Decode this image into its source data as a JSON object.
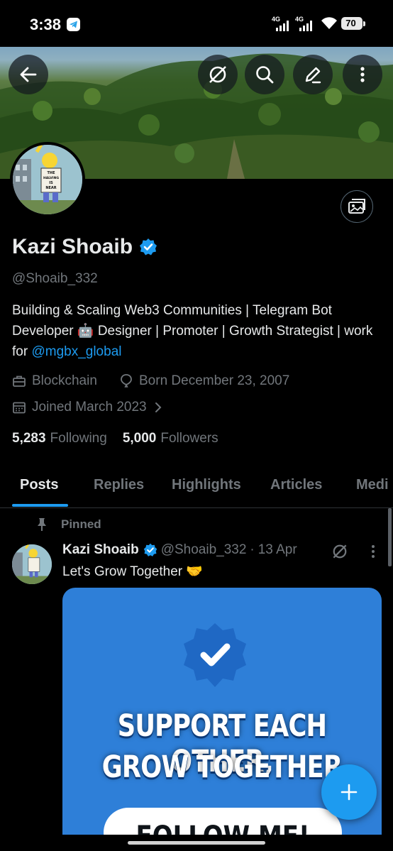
{
  "status_bar": {
    "time": "3:38",
    "signal_1_label": "4G",
    "signal_2_label": "4G",
    "battery": "70"
  },
  "header": {
    "back_icon": "arrow-left-icon",
    "grok_icon": "grok-icon",
    "search_icon": "search-icon",
    "edit_icon": "pencil-icon",
    "more_icon": "more-vertical-icon"
  },
  "profile": {
    "name": "Kazi Shoaib",
    "handle": "@Shoaib_332",
    "bio_text": "Building & Scaling Web3 Communities | Telegram Bot Developer 🤖 Designer | Promoter | Growth Strategist | work for ",
    "bio_link": "@mgbx_global",
    "category": "Blockchain",
    "born": "Born December 23, 2007",
    "joined": "Joined March 2023",
    "following_count": "5,283",
    "following_label": "Following",
    "followers_count": "5,000",
    "followers_label": "Followers",
    "avatar_sign": [
      "THE",
      "HALVING",
      "IS",
      "NEAR"
    ]
  },
  "tabs": [
    "Posts",
    "Replies",
    "Highlights",
    "Articles",
    "Medi"
  ],
  "active_tab": "Posts",
  "pinned_post": {
    "pinned_label": "Pinned",
    "author_name": "Kazi Shoaib",
    "author_handle": "@Shoaib_332",
    "separator": "·",
    "date": "13 Apr",
    "text": "Let's Grow Together 🤝",
    "media": {
      "line1": "SUPPORT EACH OTHER,",
      "line2": "GROW TOGETHER",
      "button_text": "FOLLOW ME!"
    }
  },
  "colors": {
    "accent": "#1d9bf0",
    "muted": "#71767b",
    "text": "#e7e9ea",
    "background": "#000000"
  }
}
